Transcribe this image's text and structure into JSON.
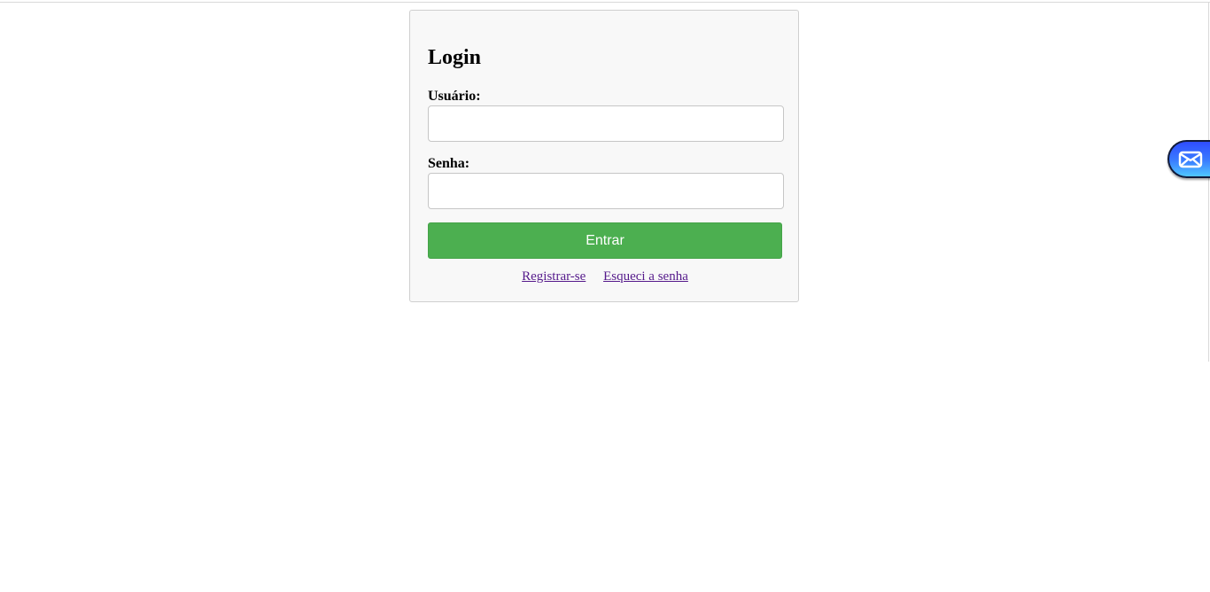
{
  "login": {
    "title": "Login",
    "username_label": "Usuário:",
    "username_value": "",
    "password_label": "Senha:",
    "password_value": "",
    "submit_label": "Entrar",
    "register_link": "Registrar-se",
    "forgot_link": "Esqueci a senha"
  },
  "widget": {
    "icon": "mail-icon",
    "accent_color": "#3a6cff"
  },
  "colors": {
    "submit_button": "#4caf50",
    "visited_link": "#551a8b",
    "panel_background": "#f8f8f8"
  }
}
